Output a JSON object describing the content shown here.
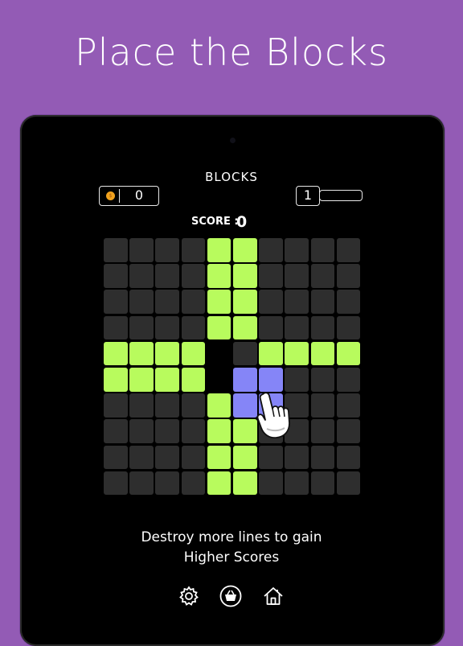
{
  "promo": {
    "headline": "Place the Blocks"
  },
  "header": {
    "title": "BLOCKS"
  },
  "coins": {
    "value": "0",
    "icon": "coin-icon"
  },
  "level": {
    "value": "1",
    "progress": 0
  },
  "score": {
    "label": "SCORE :",
    "value": "0"
  },
  "board": {
    "size": 10,
    "legend": {
      "g": "filled-green",
      "p": "active-piece-purple",
      "e": "cleared-empty",
      ".": "empty"
    },
    "rows": [
      "....gg....",
      "....gg....",
      "....gg....",
      "....gg....",
      "gggge.gggg",
      "ggggepp...",
      "....gpp...",
      "....gg....",
      "....gg....",
      "....gg...."
    ]
  },
  "tip": {
    "line1": "Destroy more lines to gain",
    "line2": "Higher Scores"
  },
  "toolbar": {
    "settings_icon": "gear-icon",
    "shop_icon": "basket-icon",
    "home_icon": "home-icon"
  },
  "colors": {
    "background": "#935bb5",
    "device": "#000000",
    "cell_empty": "#2e2e2e",
    "cell_filled": "#b8fb5d",
    "piece": "#8585f7",
    "coin": "#f0a21e"
  }
}
